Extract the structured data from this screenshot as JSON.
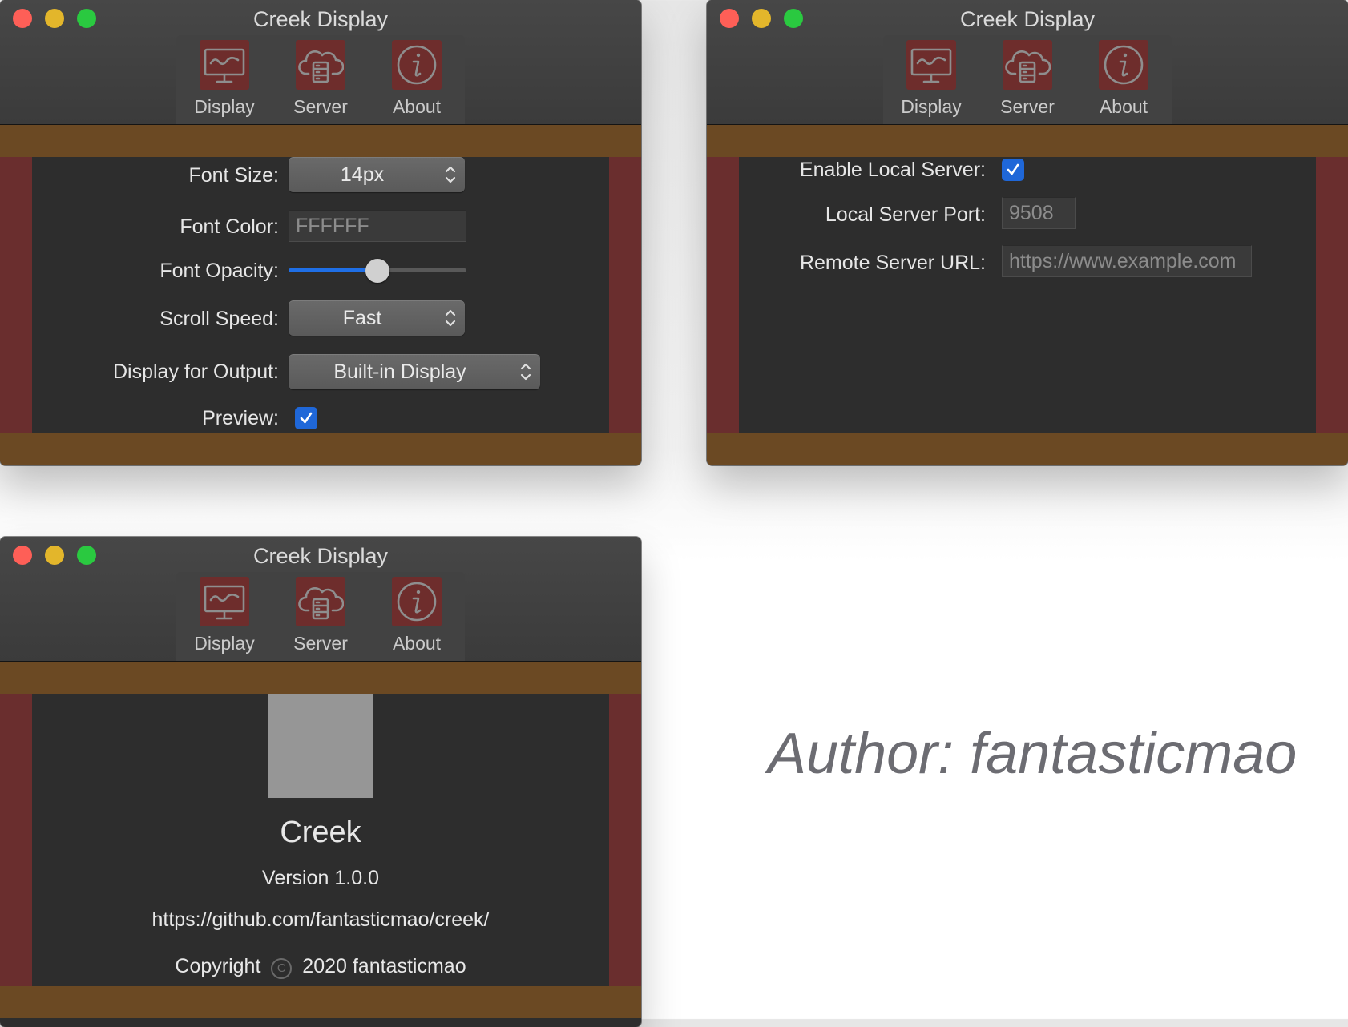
{
  "window_title": "Creek Display",
  "toolbar": {
    "display": {
      "label": "Display",
      "icon": "monitor-icon"
    },
    "server": {
      "label": "Server",
      "icon": "cloud-server-icon"
    },
    "about": {
      "label": "About",
      "icon": "info-icon"
    }
  },
  "display_pane": {
    "font_size": {
      "label": "Font Size:",
      "value": "14px"
    },
    "font_color": {
      "label": "Font Color:",
      "placeholder": "FFFFFF"
    },
    "font_opacity": {
      "label": "Font Opacity:",
      "value_fraction": 0.5
    },
    "scroll_speed": {
      "label": "Scroll Speed:",
      "value": "Fast"
    },
    "display_output": {
      "label": "Display for Output:",
      "value": "Built-in Display"
    },
    "preview": {
      "label": "Preview:",
      "checked": true
    }
  },
  "server_pane": {
    "enable_local": {
      "label": "Enable Local Server:",
      "checked": true
    },
    "local_port": {
      "label": "Local Server Port:",
      "placeholder": "9508"
    },
    "remote_url": {
      "label": "Remote Server URL:",
      "placeholder": "https://www.example.com"
    }
  },
  "about_pane": {
    "app_name": "Creek",
    "version": "Version 1.0.0",
    "url": "https://github.com/fantasticmao/creek/",
    "copyright_prefix": "Copyright",
    "copyright_rest": "2020 fantasticmao"
  },
  "author_caption": "Author: fantasticmao",
  "colors": {
    "accent": "#1f67d8",
    "side_band": "#6a2e2e",
    "brown_band": "#6b4923",
    "icon_bg": "#6e2d2c"
  }
}
